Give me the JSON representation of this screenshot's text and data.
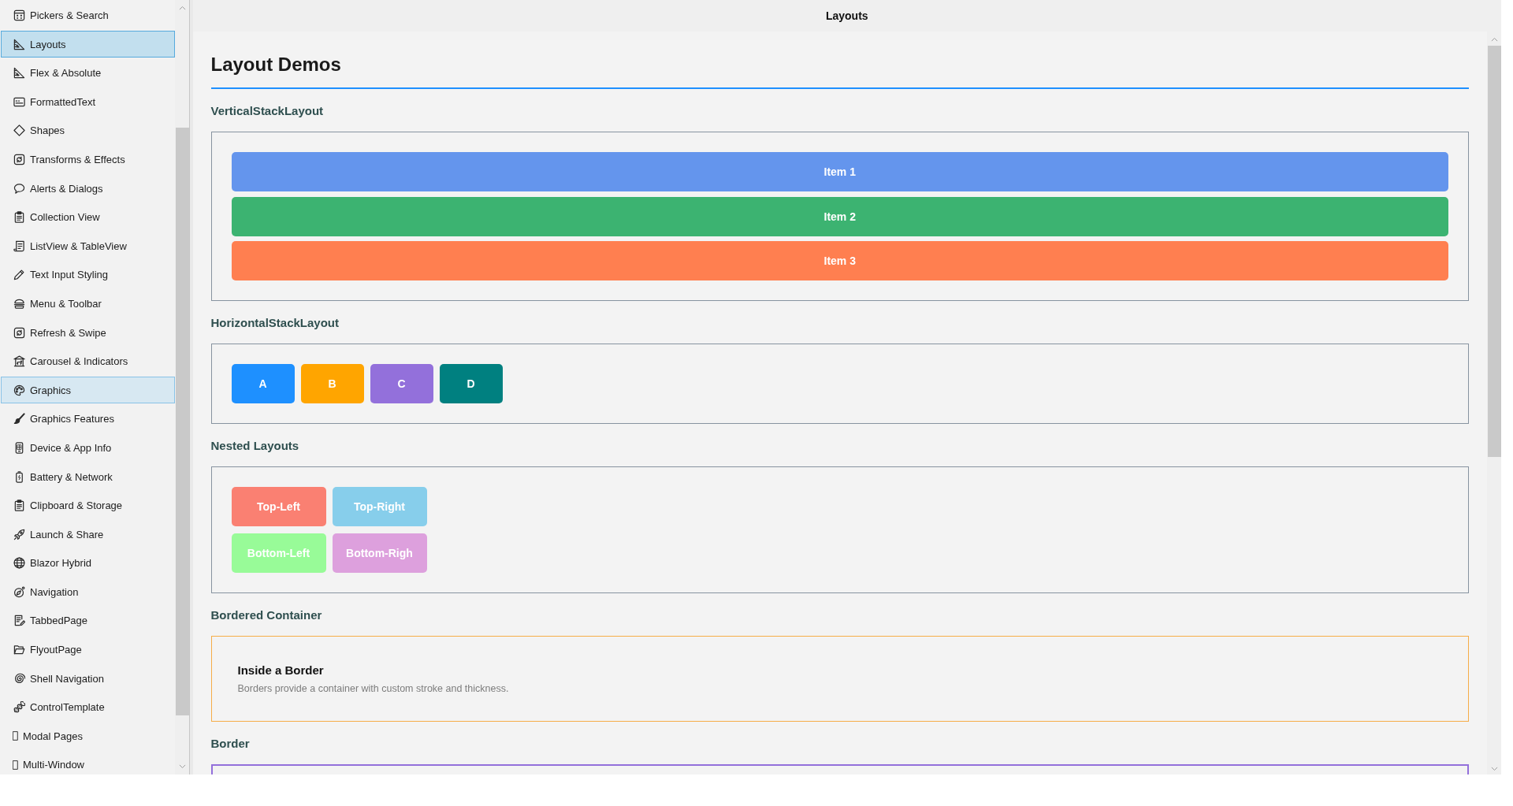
{
  "sidebar": {
    "items": [
      {
        "label": "Pickers & Search",
        "selected": false,
        "hovered": false
      },
      {
        "label": "Layouts",
        "selected": true,
        "hovered": false
      },
      {
        "label": "Flex & Absolute",
        "selected": false,
        "hovered": false
      },
      {
        "label": "FormattedText",
        "selected": false,
        "hovered": false
      },
      {
        "label": "Shapes",
        "selected": false,
        "hovered": false
      },
      {
        "label": "Transforms & Effects",
        "selected": false,
        "hovered": false
      },
      {
        "label": "Alerts & Dialogs",
        "selected": false,
        "hovered": false
      },
      {
        "label": "Collection View",
        "selected": false,
        "hovered": false
      },
      {
        "label": "ListView & TableView",
        "selected": false,
        "hovered": false
      },
      {
        "label": "Text Input Styling",
        "selected": false,
        "hovered": false
      },
      {
        "label": "Menu & Toolbar",
        "selected": false,
        "hovered": false
      },
      {
        "label": "Refresh & Swipe",
        "selected": false,
        "hovered": false
      },
      {
        "label": "Carousel & Indicators",
        "selected": false,
        "hovered": false
      },
      {
        "label": "Graphics",
        "selected": false,
        "hovered": true
      },
      {
        "label": "Graphics Features",
        "selected": false,
        "hovered": false
      },
      {
        "label": "Device & App Info",
        "selected": false,
        "hovered": false
      },
      {
        "label": "Battery & Network",
        "selected": false,
        "hovered": false
      },
      {
        "label": "Clipboard & Storage",
        "selected": false,
        "hovered": false
      },
      {
        "label": "Launch & Share",
        "selected": false,
        "hovered": false
      },
      {
        "label": "Blazor Hybrid",
        "selected": false,
        "hovered": false
      },
      {
        "label": "Navigation",
        "selected": false,
        "hovered": false
      },
      {
        "label": "TabbedPage",
        "selected": false,
        "hovered": false
      },
      {
        "label": "FlyoutPage",
        "selected": false,
        "hovered": false
      },
      {
        "label": "Shell Navigation",
        "selected": false,
        "hovered": false
      },
      {
        "label": "ControlTemplate",
        "selected": false,
        "hovered": false
      },
      {
        "label": "Modal Pages",
        "selected": false,
        "hovered": false
      },
      {
        "label": "Multi-Window",
        "selected": false,
        "hovered": false
      }
    ]
  },
  "header": {
    "title": "Layouts"
  },
  "page": {
    "title": "Layout Demos",
    "sections": [
      {
        "kind": "vertical",
        "heading": "VerticalStackLayout",
        "items": [
          {
            "label": "Item 1",
            "color": "#6495ed"
          },
          {
            "label": "Item 2",
            "color": "#3cb371"
          },
          {
            "label": "Item 3",
            "color": "#ff7f50"
          }
        ]
      },
      {
        "kind": "horizontal",
        "heading": "HorizontalStackLayout",
        "items": [
          {
            "label": "A",
            "color": "#1e90ff"
          },
          {
            "label": "B",
            "color": "#ffa500"
          },
          {
            "label": "C",
            "color": "#9370db"
          },
          {
            "label": "D",
            "color": "#008080"
          }
        ]
      },
      {
        "kind": "grid",
        "heading": "Nested Layouts",
        "items": [
          {
            "label": "Top-Left",
            "color": "#fa8072"
          },
          {
            "label": "Top-Right",
            "color": "#87ceeb"
          },
          {
            "label": "Bottom-Left",
            "color": "#98fb98"
          },
          {
            "label": "Bottom-Righ",
            "color": "#dda0dd"
          }
        ]
      },
      {
        "kind": "bordered",
        "heading": "Bordered Container",
        "title": "Inside a Border",
        "text": "Borders provide a container with custom stroke and thickness."
      },
      {
        "kind": "border",
        "heading": "Border"
      }
    ]
  }
}
